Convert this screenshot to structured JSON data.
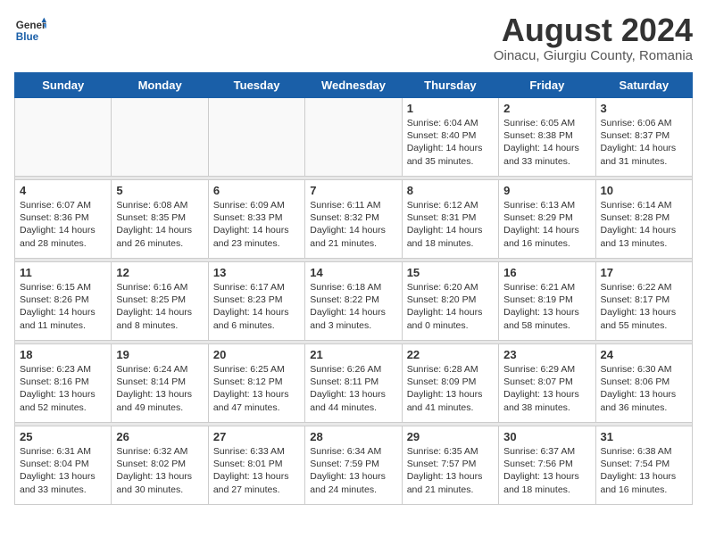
{
  "header": {
    "logo_general": "General",
    "logo_blue": "Blue",
    "month_title": "August 2024",
    "location": "Oinacu, Giurgiu County, Romania"
  },
  "weekdays": [
    "Sunday",
    "Monday",
    "Tuesday",
    "Wednesday",
    "Thursday",
    "Friday",
    "Saturday"
  ],
  "weeks": [
    [
      {
        "day": "",
        "info": ""
      },
      {
        "day": "",
        "info": ""
      },
      {
        "day": "",
        "info": ""
      },
      {
        "day": "",
        "info": ""
      },
      {
        "day": "1",
        "info": "Sunrise: 6:04 AM\nSunset: 8:40 PM\nDaylight: 14 hours\nand 35 minutes."
      },
      {
        "day": "2",
        "info": "Sunrise: 6:05 AM\nSunset: 8:38 PM\nDaylight: 14 hours\nand 33 minutes."
      },
      {
        "day": "3",
        "info": "Sunrise: 6:06 AM\nSunset: 8:37 PM\nDaylight: 14 hours\nand 31 minutes."
      }
    ],
    [
      {
        "day": "4",
        "info": "Sunrise: 6:07 AM\nSunset: 8:36 PM\nDaylight: 14 hours\nand 28 minutes."
      },
      {
        "day": "5",
        "info": "Sunrise: 6:08 AM\nSunset: 8:35 PM\nDaylight: 14 hours\nand 26 minutes."
      },
      {
        "day": "6",
        "info": "Sunrise: 6:09 AM\nSunset: 8:33 PM\nDaylight: 14 hours\nand 23 minutes."
      },
      {
        "day": "7",
        "info": "Sunrise: 6:11 AM\nSunset: 8:32 PM\nDaylight: 14 hours\nand 21 minutes."
      },
      {
        "day": "8",
        "info": "Sunrise: 6:12 AM\nSunset: 8:31 PM\nDaylight: 14 hours\nand 18 minutes."
      },
      {
        "day": "9",
        "info": "Sunrise: 6:13 AM\nSunset: 8:29 PM\nDaylight: 14 hours\nand 16 minutes."
      },
      {
        "day": "10",
        "info": "Sunrise: 6:14 AM\nSunset: 8:28 PM\nDaylight: 14 hours\nand 13 minutes."
      }
    ],
    [
      {
        "day": "11",
        "info": "Sunrise: 6:15 AM\nSunset: 8:26 PM\nDaylight: 14 hours\nand 11 minutes."
      },
      {
        "day": "12",
        "info": "Sunrise: 6:16 AM\nSunset: 8:25 PM\nDaylight: 14 hours\nand 8 minutes."
      },
      {
        "day": "13",
        "info": "Sunrise: 6:17 AM\nSunset: 8:23 PM\nDaylight: 14 hours\nand 6 minutes."
      },
      {
        "day": "14",
        "info": "Sunrise: 6:18 AM\nSunset: 8:22 PM\nDaylight: 14 hours\nand 3 minutes."
      },
      {
        "day": "15",
        "info": "Sunrise: 6:20 AM\nSunset: 8:20 PM\nDaylight: 14 hours\nand 0 minutes."
      },
      {
        "day": "16",
        "info": "Sunrise: 6:21 AM\nSunset: 8:19 PM\nDaylight: 13 hours\nand 58 minutes."
      },
      {
        "day": "17",
        "info": "Sunrise: 6:22 AM\nSunset: 8:17 PM\nDaylight: 13 hours\nand 55 minutes."
      }
    ],
    [
      {
        "day": "18",
        "info": "Sunrise: 6:23 AM\nSunset: 8:16 PM\nDaylight: 13 hours\nand 52 minutes."
      },
      {
        "day": "19",
        "info": "Sunrise: 6:24 AM\nSunset: 8:14 PM\nDaylight: 13 hours\nand 49 minutes."
      },
      {
        "day": "20",
        "info": "Sunrise: 6:25 AM\nSunset: 8:12 PM\nDaylight: 13 hours\nand 47 minutes."
      },
      {
        "day": "21",
        "info": "Sunrise: 6:26 AM\nSunset: 8:11 PM\nDaylight: 13 hours\nand 44 minutes."
      },
      {
        "day": "22",
        "info": "Sunrise: 6:28 AM\nSunset: 8:09 PM\nDaylight: 13 hours\nand 41 minutes."
      },
      {
        "day": "23",
        "info": "Sunrise: 6:29 AM\nSunset: 8:07 PM\nDaylight: 13 hours\nand 38 minutes."
      },
      {
        "day": "24",
        "info": "Sunrise: 6:30 AM\nSunset: 8:06 PM\nDaylight: 13 hours\nand 36 minutes."
      }
    ],
    [
      {
        "day": "25",
        "info": "Sunrise: 6:31 AM\nSunset: 8:04 PM\nDaylight: 13 hours\nand 33 minutes."
      },
      {
        "day": "26",
        "info": "Sunrise: 6:32 AM\nSunset: 8:02 PM\nDaylight: 13 hours\nand 30 minutes."
      },
      {
        "day": "27",
        "info": "Sunrise: 6:33 AM\nSunset: 8:01 PM\nDaylight: 13 hours\nand 27 minutes."
      },
      {
        "day": "28",
        "info": "Sunrise: 6:34 AM\nSunset: 7:59 PM\nDaylight: 13 hours\nand 24 minutes."
      },
      {
        "day": "29",
        "info": "Sunrise: 6:35 AM\nSunset: 7:57 PM\nDaylight: 13 hours\nand 21 minutes."
      },
      {
        "day": "30",
        "info": "Sunrise: 6:37 AM\nSunset: 7:56 PM\nDaylight: 13 hours\nand 18 minutes."
      },
      {
        "day": "31",
        "info": "Sunrise: 6:38 AM\nSunset: 7:54 PM\nDaylight: 13 hours\nand 16 minutes."
      }
    ]
  ]
}
